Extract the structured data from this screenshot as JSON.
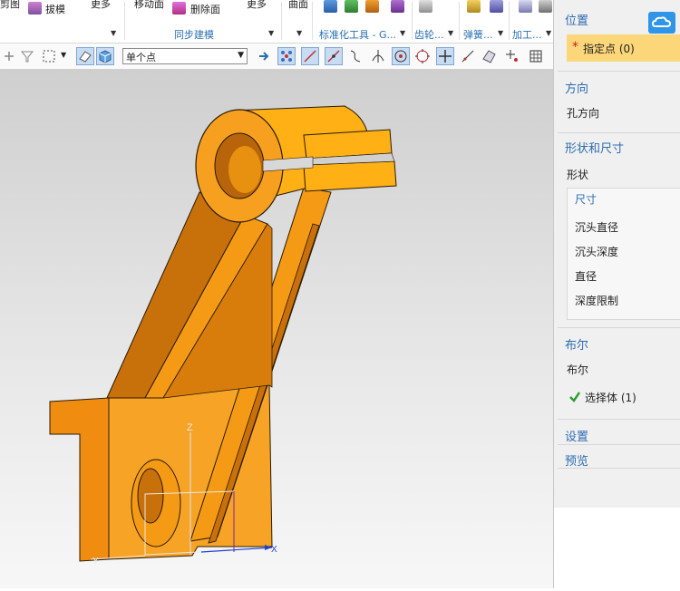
{
  "ribbon": {
    "items": [
      {
        "label": "剪图",
        "name": "trim-label"
      },
      {
        "label": "拔模",
        "name": "draft-label"
      },
      {
        "label": "更多",
        "name": "more-label-1"
      },
      {
        "label": "移动面",
        "name": "move-face-label"
      },
      {
        "label": "删除面",
        "name": "delete-face-label"
      },
      {
        "label": "更多",
        "name": "more-label-2"
      },
      {
        "label": "曲面",
        "name": "surface-label"
      }
    ],
    "groups": [
      {
        "label": "同步建模"
      },
      {
        "label": "标准化工具 - G..."
      },
      {
        "label": "齿轮..."
      },
      {
        "label": "弹簧..."
      },
      {
        "label": "加工..."
      }
    ]
  },
  "toolbar": {
    "snap_mode": "单个点"
  },
  "panel": {
    "position": {
      "title": "位置",
      "select_point": "指定点 (0)"
    },
    "direction": {
      "title": "方向",
      "hole_direction": "孔方向"
    },
    "form": {
      "title": "形状和尺寸",
      "shape_label": "形状",
      "dims_title": "尺寸",
      "dims": [
        "沉头直径",
        "沉头深度",
        "直径",
        "深度限制"
      ]
    },
    "boolean": {
      "title": "布尔",
      "boolean_label": "布尔",
      "select_body": "选择体 (1)"
    },
    "settings": {
      "title": "设置"
    },
    "preview": {
      "title": "预览"
    }
  },
  "viewport": {
    "axis_labels": {
      "x": "X",
      "y": "Y",
      "z": "Z"
    },
    "colors": {
      "part": "#f59a12",
      "part_light": "#ffb11a",
      "part_dark": "#c86f08",
      "edge": "#2a1a05"
    }
  }
}
